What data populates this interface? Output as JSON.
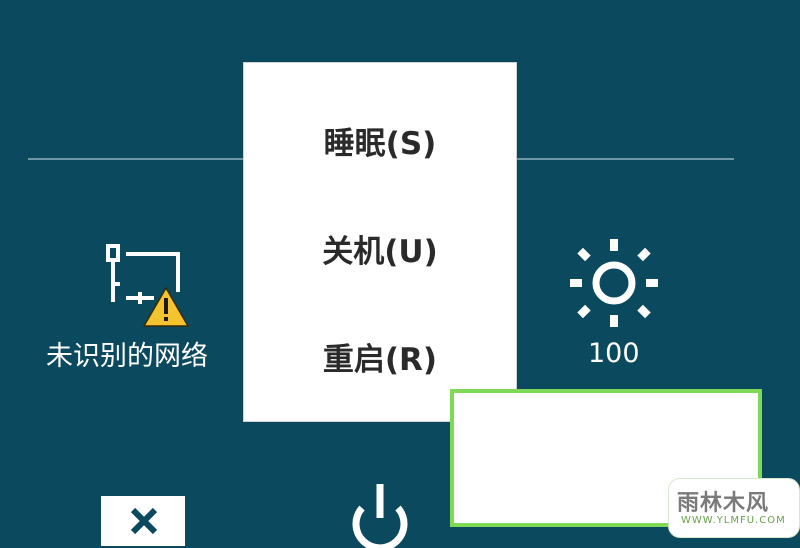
{
  "power_menu": {
    "items": [
      {
        "label": "睡眠(S)"
      },
      {
        "label": "关机(U)"
      },
      {
        "label": "重启(R)"
      }
    ]
  },
  "tiles": {
    "network": {
      "label": "未识别的网络",
      "icon": "network-warning-icon"
    },
    "brightness": {
      "label": "100",
      "icon": "brightness-sun-icon"
    }
  },
  "bottom_bar": {
    "close_icon": "close-icon",
    "power_icon": "power-icon"
  },
  "watermark": {
    "text": "雨林木风",
    "sub": "WWW.YLMFU.COM"
  },
  "colors": {
    "background": "#0b4a5e",
    "menu_bg": "#ffffff",
    "highlight_border": "#7ed957",
    "warning": "#f4c430"
  }
}
